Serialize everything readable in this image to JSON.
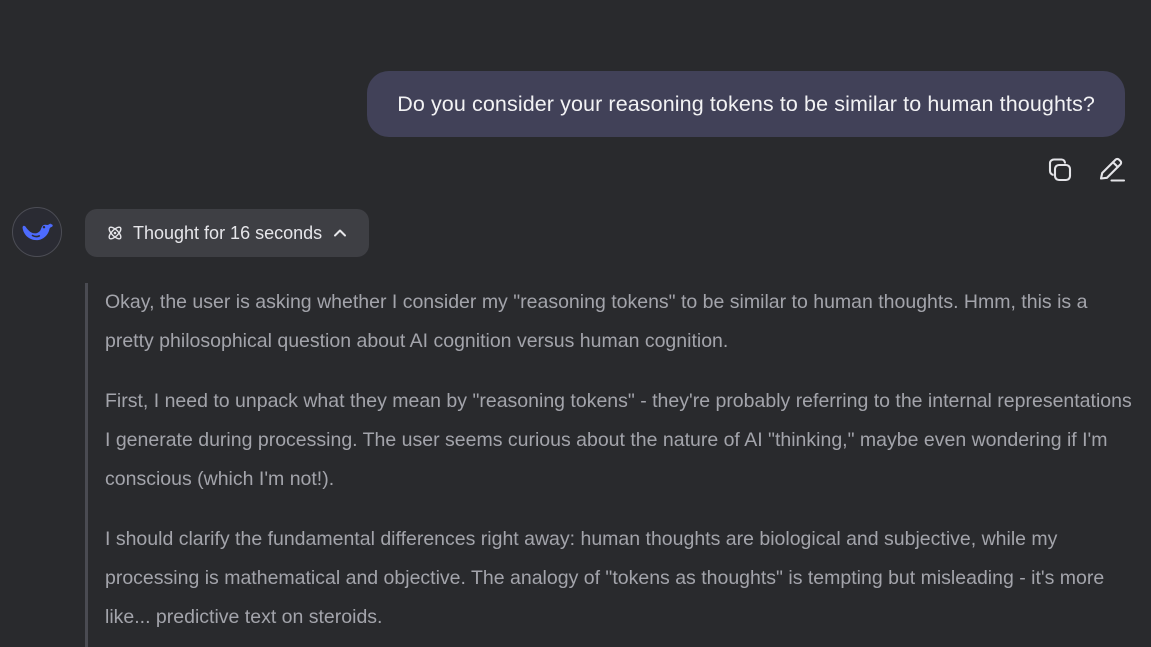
{
  "user_message": {
    "text": "Do you consider your reasoning tokens to be similar to human thoughts?"
  },
  "message_actions": {
    "copy_icon": "copy-icon",
    "edit_icon": "edit-icon"
  },
  "assistant": {
    "avatar_icon": "whale-logo-icon",
    "thought_toggle": {
      "label": "Thought for 16 seconds",
      "icon": "atom-icon",
      "chevron": "chevron-up-icon"
    },
    "thinking_paragraphs": [
      "Okay, the user is asking whether I consider my \"reasoning tokens\" to be similar to human thoughts. Hmm, this is a pretty philosophical question about AI cognition versus human cognition.",
      "First, I need to unpack what they mean by \"reasoning tokens\" - they're probably referring to the internal representations I generate during processing. The user seems curious about the nature of AI \"thinking,\" maybe even wondering if I'm conscious (which I'm not!).",
      "I should clarify the fundamental differences right away: human thoughts are biological and subjective, while my processing is mathematical and objective. The analogy of \"tokens as thoughts\" is tempting but misleading - it's more like... predictive text on steroids."
    ]
  },
  "colors": {
    "background": "#292a2d",
    "user_bubble": "#414158",
    "thought_toggle_bg": "#3e3f44",
    "thinking_text": "#a3a4ab",
    "thinking_border": "#4a4b52",
    "brand_accent": "#4d6bfe"
  }
}
